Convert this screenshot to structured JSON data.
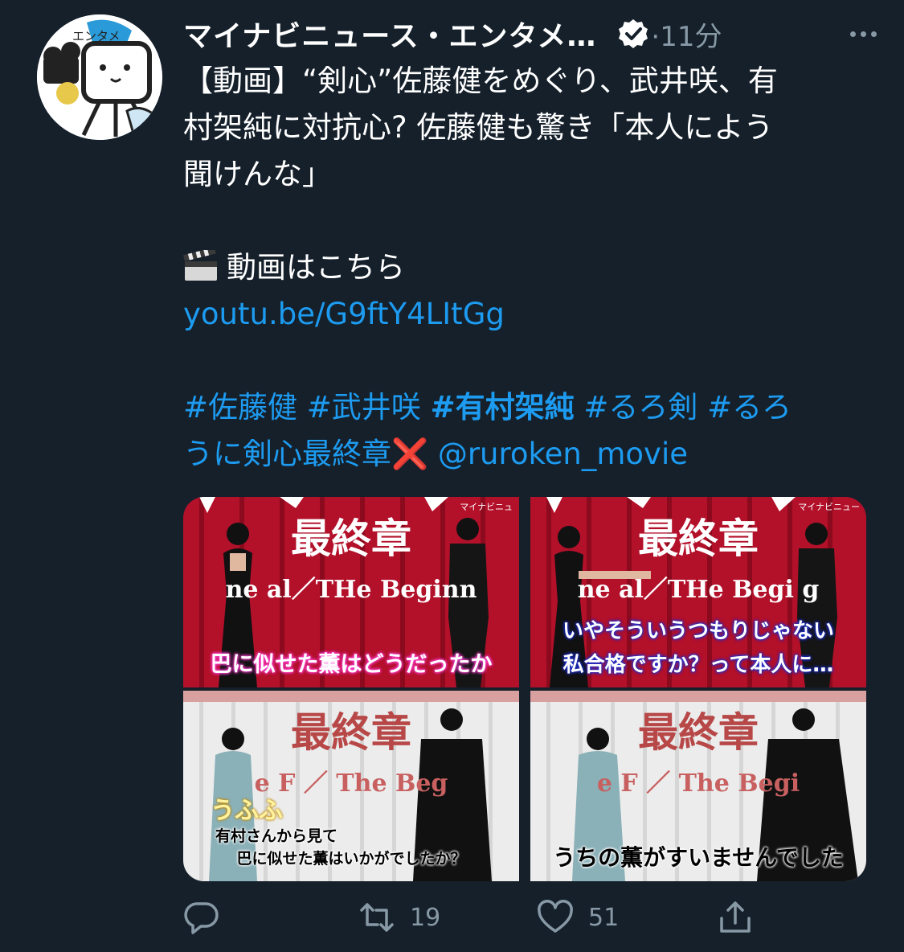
{
  "tweet": {
    "display_name": "マイナビニュース・エンタメ…",
    "timestamp": "·11分",
    "avatar_text": "エンタメ",
    "text": {
      "line1": "【動画】“剣心”佐藤健をめぐり、武井咲、有",
      "line2": "村架純に対抗心? 佐藤健も驚き「本人によう",
      "line3": "聞けんな」",
      "video_label": "動画はこちら",
      "link": "youtu.be/G9ftY4LItGg",
      "hashtags": [
        "#佐藤健",
        "#武井咲",
        "#有村架純",
        "#るろ剣",
        "#るろ"
      ],
      "hashtag_cont": "うに剣心最終章",
      "cross": "❌",
      "mention": "@ruroken_movie"
    },
    "media": [
      {
        "title": "最終章",
        "eng": "ne   al／THe Beginn",
        "brand": "マイナビニュ",
        "captions": [
          "巴に似せた薫はどうだったか"
        ]
      },
      {
        "title": "最終章",
        "eng": "ne   al／THe Begi    g",
        "brand": "マイナビニュー",
        "captions": [
          "いやそういうつもりじゃない",
          "私合格ですか？って本人に…"
        ]
      },
      {
        "title": "最終章",
        "eng": "e F     ／ The Beg",
        "captions": [
          "うふふ",
          "有村さんから見て",
          "巴に似せた薫はいかがでしたか？"
        ]
      },
      {
        "title": "最終章",
        "eng": "e F    ／ The Begi",
        "captions": [
          "うちの薫がすいませんでした"
        ]
      }
    ],
    "actions": {
      "retweets": "19",
      "likes": "51"
    }
  },
  "colors": {
    "background": "#15202b",
    "link": "#1d9bf0",
    "secondary": "#8899a6",
    "stage_red": "#c0132a",
    "stage_white": "#eeeeee"
  }
}
